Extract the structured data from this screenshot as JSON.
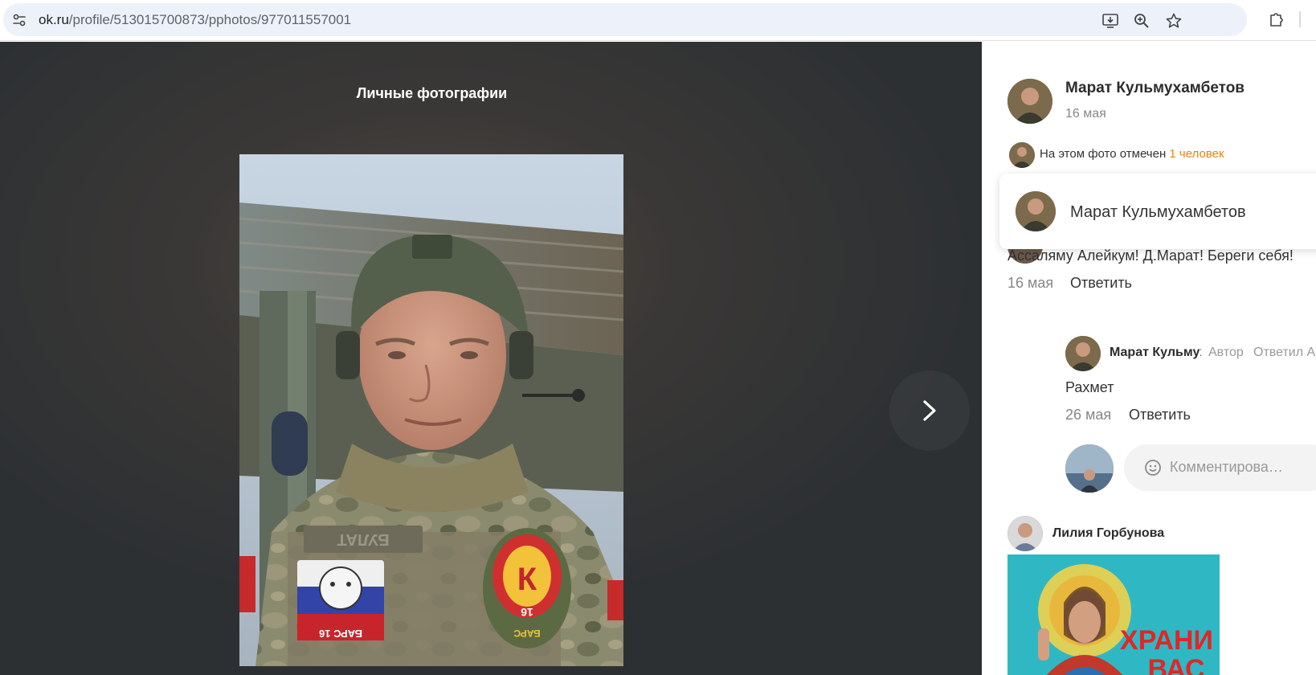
{
  "browser": {
    "url_host": "ok.ru",
    "url_path": "/profile/513015700873/pphotos/977011557001",
    "icons": [
      "site-info-icon",
      "install-app-icon",
      "zoom-icon",
      "bookmark-star-icon",
      "extensions-icon"
    ]
  },
  "viewer": {
    "album_title": "Личные фотографии",
    "photo_patch_name": "БУЛАТ",
    "photo_patch_bars": "БАРС 16",
    "photo_emblem_text": "БАРС",
    "photo_emblem_number": "16",
    "next_icon": "chevron-right-icon"
  },
  "post": {
    "author": "Марат Кульмухамбетов",
    "date": "16 мая",
    "tag_text": "На этом фото отмечен ",
    "tag_link": "1 человек",
    "popup_name": "Марат Кульмухамбетов"
  },
  "comments": [
    {
      "text": "Ассаляму Алейкум! Д.Марат! Береги себя!",
      "date": "16 мая",
      "reply_label": "Ответить"
    }
  ],
  "reply": {
    "author": "Марат Кульмухамбетов",
    "author_badge": "Автор",
    "replied_to": "Ответил А",
    "text": "Рахмет",
    "date": "26 мая",
    "reply_label": "Ответить"
  },
  "comment_input": {
    "placeholder": "Комментирова…",
    "icon": "smile-icon"
  },
  "next_post": {
    "author": "Лилия Горбунова",
    "image_text_line1": "ХРАНИ",
    "image_text_line2": "ВАС"
  },
  "colors": {
    "accent_link": "#ee8208",
    "viewer_bg": "#3a3836",
    "urlbar_bg": "#edf1f9"
  }
}
